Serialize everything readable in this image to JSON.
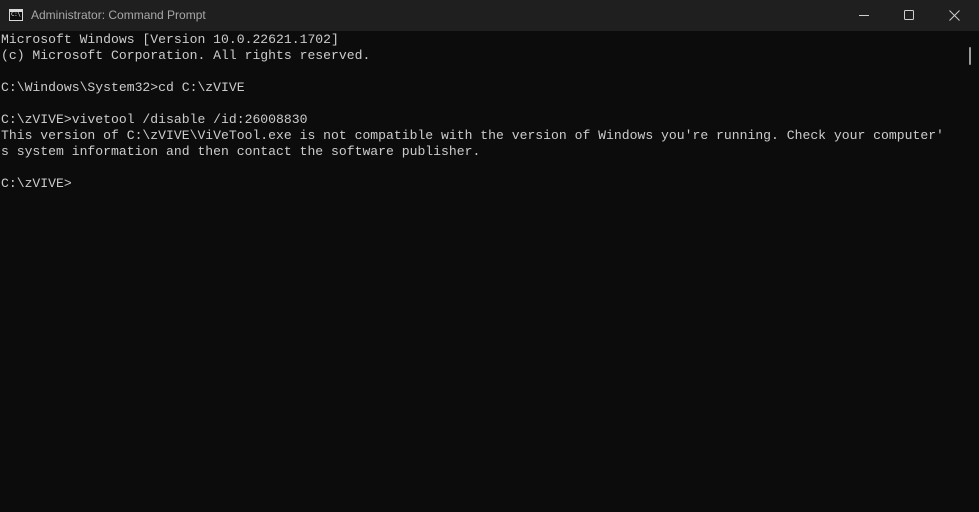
{
  "window": {
    "title": "Administrator: Command Prompt",
    "icon": "cmd-icon",
    "icon_glyph": "C:\\"
  },
  "controls": {
    "minimize": "minimize-icon",
    "maximize": "maximize-icon",
    "close": "close-icon"
  },
  "console": {
    "lines": [
      "Microsoft Windows [Version 10.0.22621.1702]",
      "(c) Microsoft Corporation. All rights reserved.",
      "",
      "C:\\Windows\\System32>cd C:\\zVIVE",
      "",
      "C:\\zVIVE>vivetool /disable /id:26008830",
      "This version of C:\\zVIVE\\ViVeTool.exe is not compatible with the version of Windows you're running. Check your computer'",
      "s system information and then contact the software publisher.",
      "",
      "C:\\zVIVE>"
    ]
  },
  "colors": {
    "background": "#0c0c0c",
    "titlebar": "#1f1f1f",
    "text": "#cccccc"
  }
}
